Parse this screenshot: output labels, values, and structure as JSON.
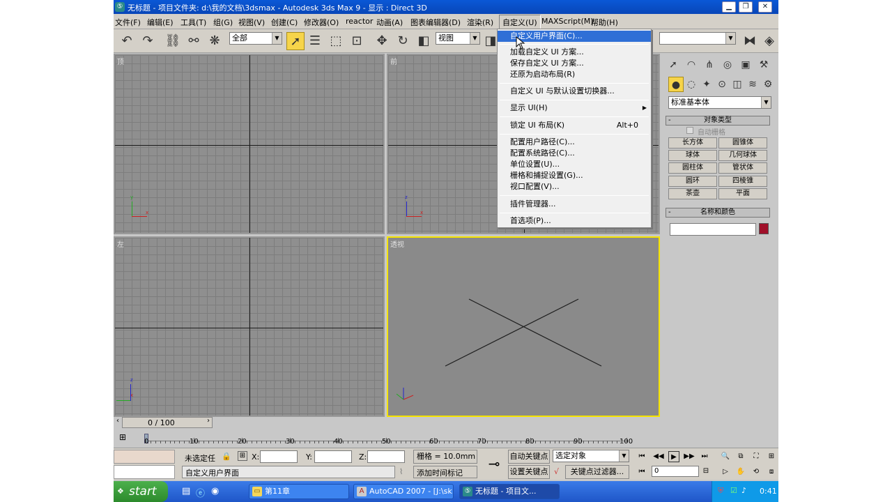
{
  "window": {
    "title": "无标题     - 项目文件夹: d:\\我的文档\\3dsmax     - Autodesk 3ds Max 9     - 显示 : Direct 3D"
  },
  "menubar": {
    "items": [
      "文件(F)",
      "编辑(E)",
      "工具(T)",
      "组(G)",
      "视图(V)",
      "创建(C)",
      "修改器(O)",
      "reactor",
      "动画(A)",
      "图表编辑器(D)",
      "渲染(R)",
      "自定义(U)",
      "MAXScript(M)",
      "帮助(H)"
    ]
  },
  "toolbar": {
    "selection_filter": "全部",
    "ref_coord": "视图",
    "named_sel": ""
  },
  "viewports": {
    "top": "顶",
    "front": "前",
    "left": "左",
    "perspective": "透视"
  },
  "axes": {
    "x": "x",
    "y": "y",
    "z": "z"
  },
  "customize_menu": {
    "items": [
      {
        "label": "自定义用户界面(C)...",
        "highlighted": true
      },
      {
        "label": "加载自定义 UI 方案..."
      },
      {
        "label": "保存自定义 UI 方案..."
      },
      {
        "label": "还原为启动布局(R)"
      },
      {
        "label": "自定义 UI 与默认设置切换器..."
      },
      {
        "label": "显示 UI(H)",
        "submenu": "▶"
      },
      {
        "label": "锁定 UI 布局(K)",
        "shortcut": "Alt+0"
      },
      {
        "label": "配置用户路径(C)..."
      },
      {
        "label": "配置系统路径(C)..."
      },
      {
        "label": "单位设置(U)..."
      },
      {
        "label": "栅格和捕捉设置(G)..."
      },
      {
        "label": "视口配置(V)..."
      },
      {
        "label": "插件管理器..."
      },
      {
        "label": "首选项(P)..."
      }
    ]
  },
  "command_panel": {
    "category_dropdown": "标准基本体",
    "object_type_header": "对象类型",
    "autogrid": "自动栅格",
    "object_buttons": [
      "长方体",
      "圆锥体",
      "球体",
      "几何球体",
      "圆柱体",
      "管状体",
      "圆环",
      "四棱锥",
      "茶壶",
      "平面"
    ],
    "name_color_header": "名称和颜色",
    "name_value": "",
    "color": "#a0102a"
  },
  "timeline": {
    "slider_text": "0 / 100",
    "ticks": [
      "0",
      "10",
      "20",
      "30",
      "40",
      "50",
      "60",
      "70",
      "80",
      "90",
      "100"
    ]
  },
  "status": {
    "selection": "未选定任",
    "prompt": "自定义用户界面",
    "x_label": "X:",
    "y_label": "Y:",
    "z_label": "Z:",
    "grid": "栅格 = 10.0mm",
    "add_time_tag": "添加时间标记",
    "auto_key": "自动关键点",
    "set_key": "设置关键点",
    "key_mode": "选定对象",
    "key_filters": "关键点过滤器...",
    "frame_value": "0"
  },
  "taskbar": {
    "start": "start",
    "tasks": [
      {
        "label": "第11章",
        "icon": "folder-icon"
      },
      {
        "label": "AutoCAD 2007 - [J:\\sk...",
        "icon": "autocad-icon"
      },
      {
        "label": "无标题     - 项目文...",
        "icon": "3dsmax-icon"
      }
    ],
    "clock": "0:41"
  },
  "colors": {
    "menu_highlight": "#2f6fd6",
    "active_viewport_border": "#f5e400",
    "titlebar": "#0a58d6",
    "taskbar": "#2d6be0"
  }
}
